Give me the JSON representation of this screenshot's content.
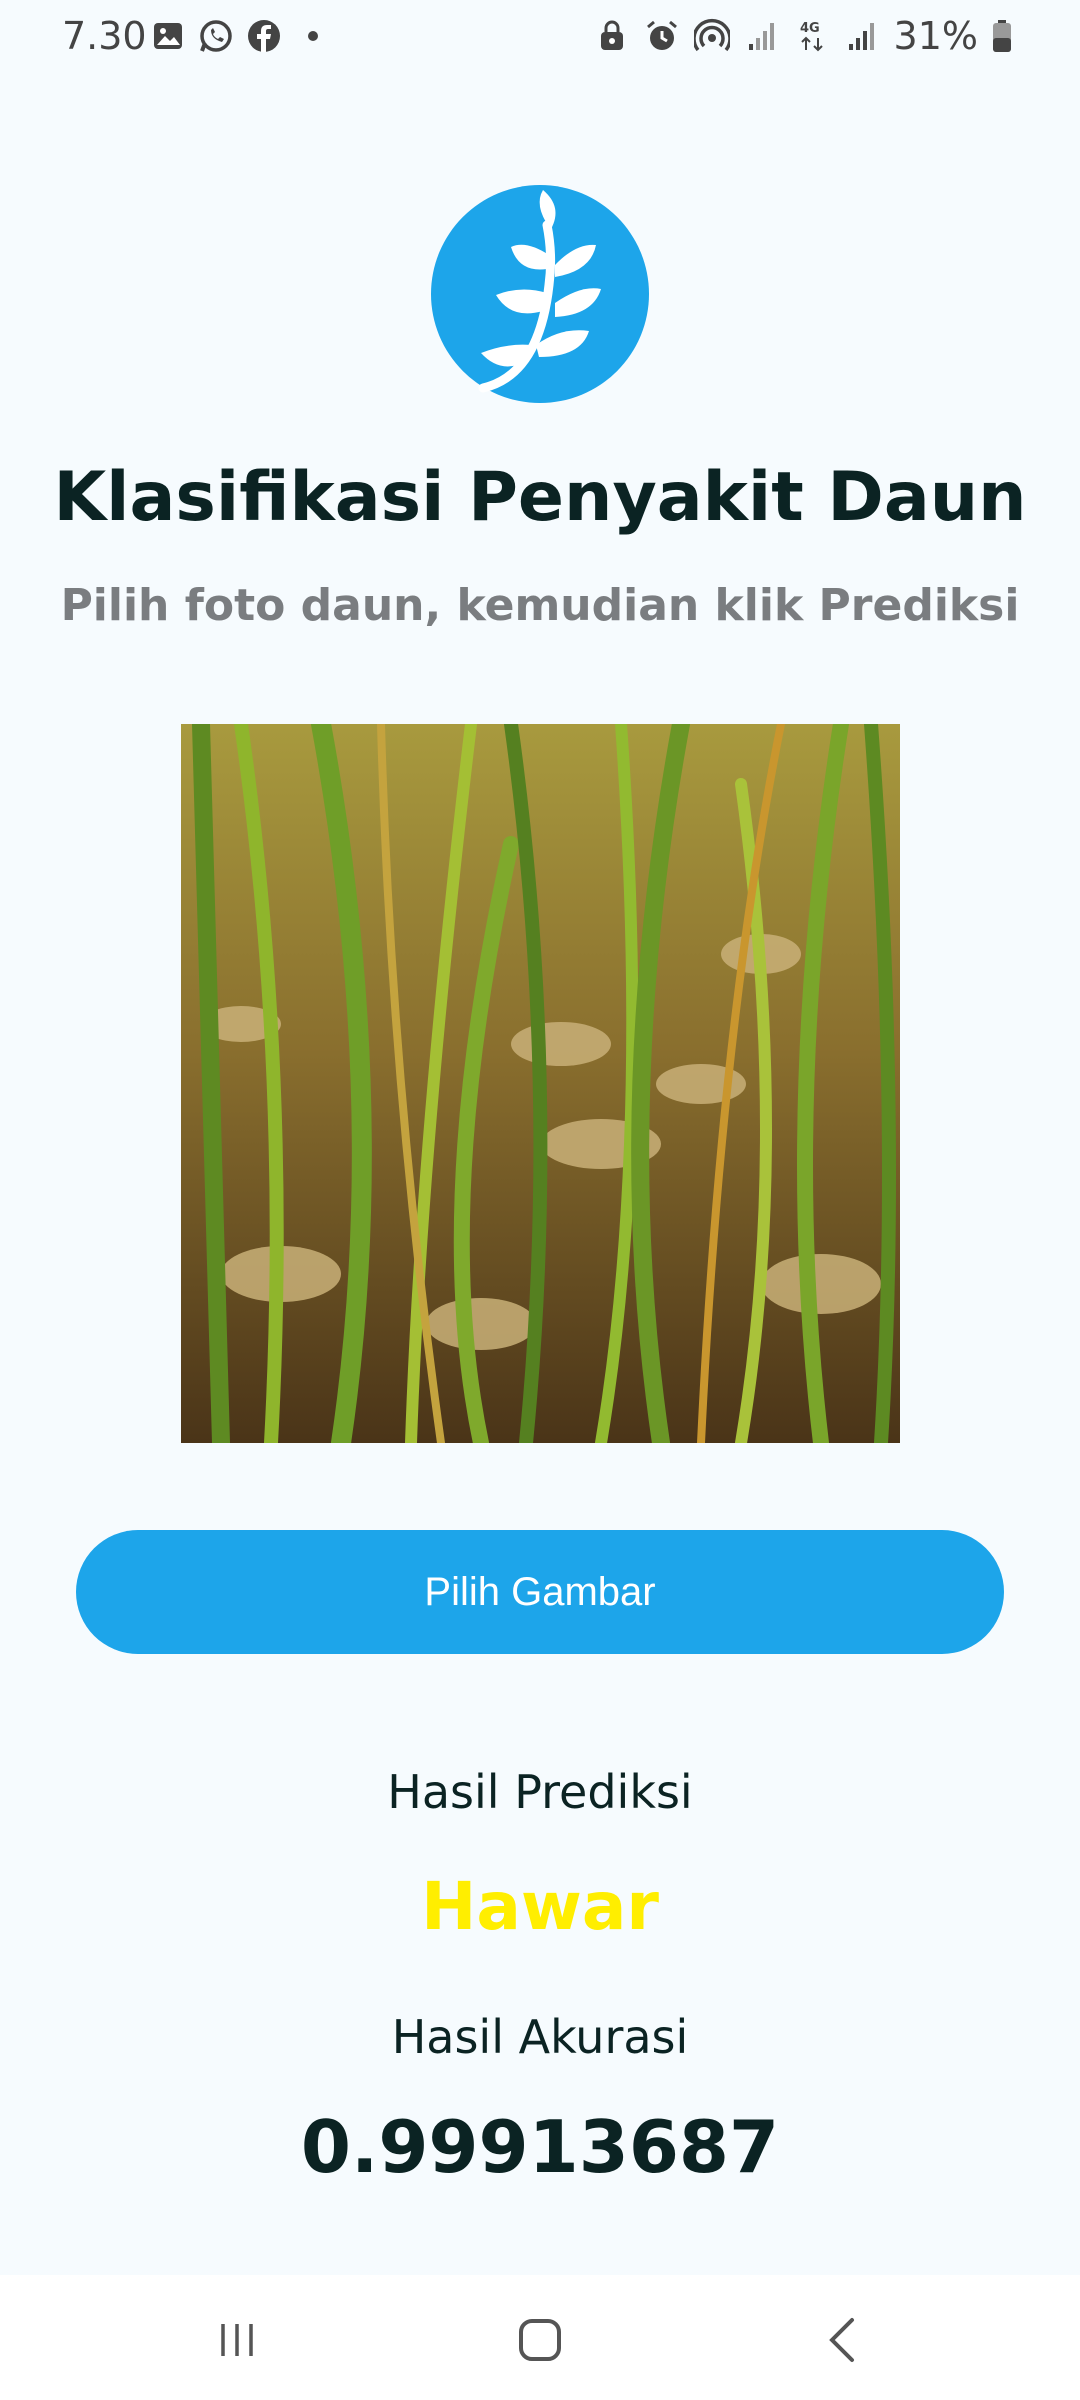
{
  "status_bar": {
    "time": "7.30",
    "battery": "31%",
    "left_icons": [
      "gallery-icon",
      "whatsapp-icon",
      "facebook-icon"
    ],
    "right_icons": [
      "lock-icon",
      "alarm-icon",
      "hotspot-icon",
      "signal-icon",
      "4g-icon",
      "signal-icon",
      "battery-icon"
    ]
  },
  "app": {
    "logo_icon": "leaf-icon",
    "title": "Klasifikasi Penyakit Daun",
    "subtitle": "Pilih foto daun, kemudian klik Prediksi",
    "image_alt": "rice-plant-photo",
    "button_label": "Pilih Gambar",
    "prediction_label": "Hasil Prediksi",
    "prediction_value": "Hawar",
    "accuracy_label": "Hasil Akurasi",
    "accuracy_value": "0.99913687"
  },
  "colors": {
    "accent": "#1da5ea",
    "prediction": "#ffee00",
    "text": "#0b2323",
    "subtitle": "#7a7d80",
    "background": "#f6fbfe"
  },
  "nav": {
    "icons": [
      "recent-apps-icon",
      "home-icon",
      "back-icon"
    ]
  }
}
